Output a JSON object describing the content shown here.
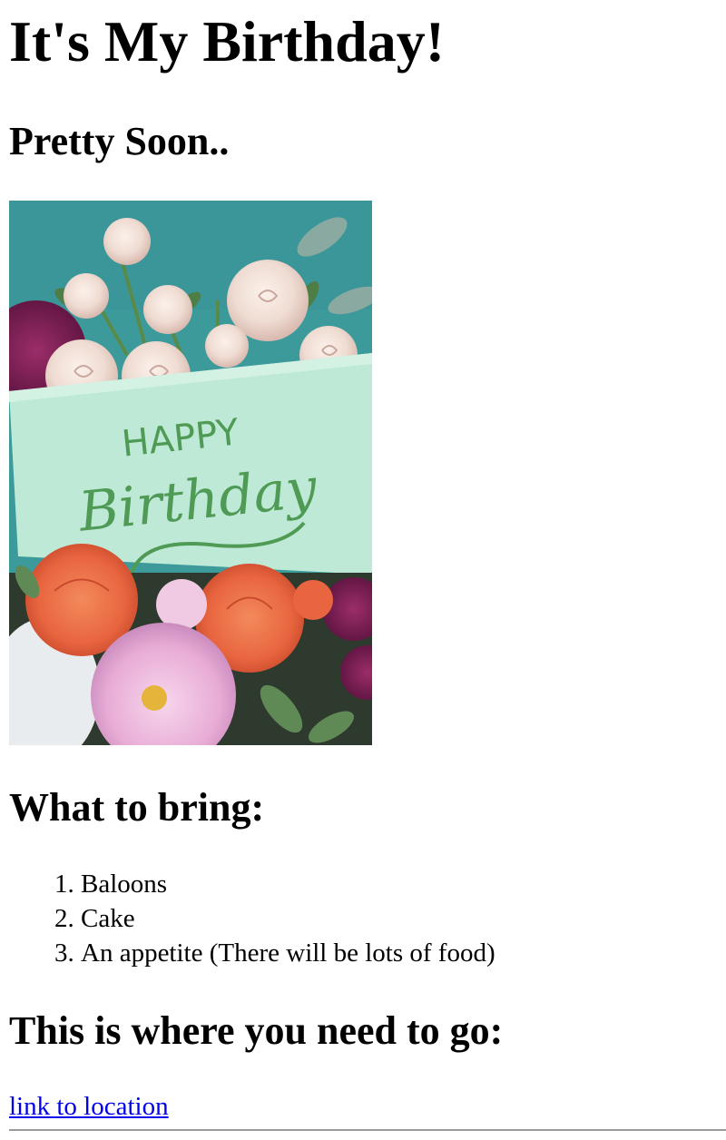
{
  "page": {
    "title": "It's My Birthday!",
    "subtitle": "Pretty Soon..",
    "image": {
      "card_line1": "HAPPY",
      "card_line2": "Birthday"
    },
    "bring_heading": "What to bring:",
    "bring_items": [
      "Baloons",
      "Cake",
      "An appetite (There will be lots of food)"
    ],
    "where_heading": "This is where you need to go:",
    "location_link": "link to location"
  },
  "colors": {
    "link": "#0000ee",
    "background": "#ffffff",
    "text": "#000000"
  }
}
